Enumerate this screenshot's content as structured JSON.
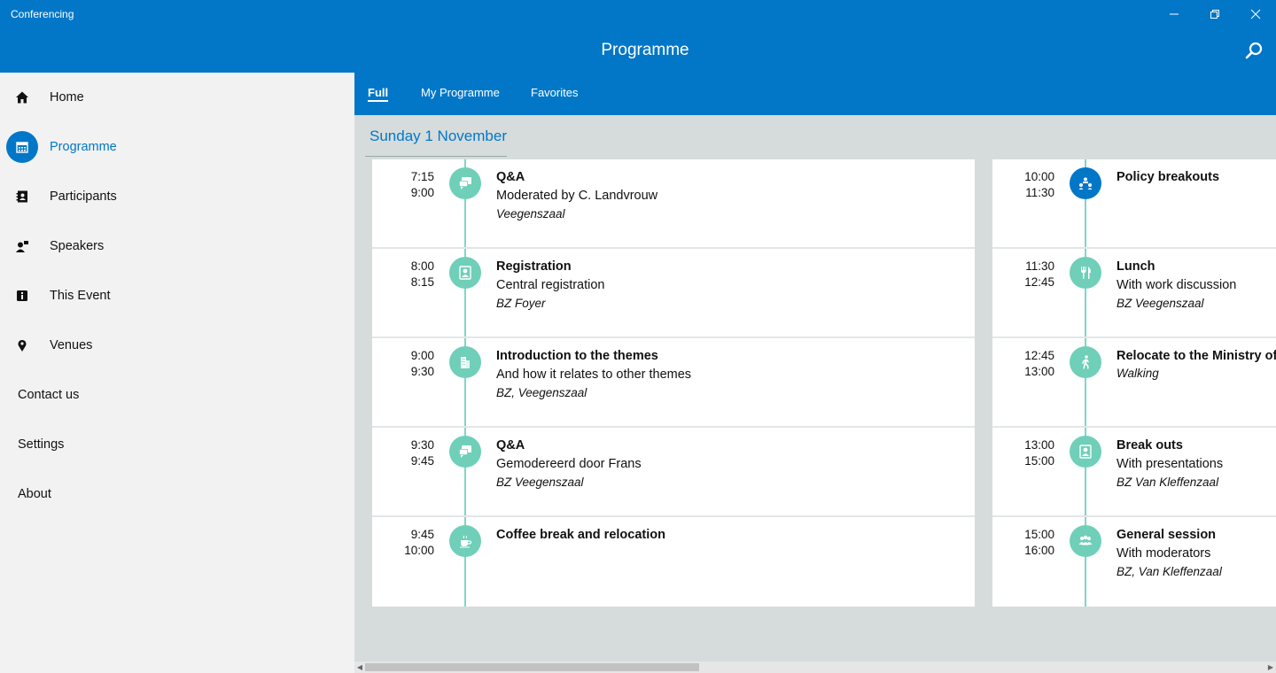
{
  "app": {
    "title": "Conferencing"
  },
  "header": {
    "page_title": "Programme"
  },
  "colors": {
    "accent": "#0277c8",
    "timeline": "#6fcfb9",
    "content_bg": "#d6dcdc"
  },
  "sidebar": {
    "items": [
      {
        "label": "Home",
        "icon": "home-icon"
      },
      {
        "label": "Programme",
        "icon": "calendar-icon",
        "active": true
      },
      {
        "label": "Participants",
        "icon": "contacts-icon"
      },
      {
        "label": "Speakers",
        "icon": "speaker-icon"
      },
      {
        "label": "This Event",
        "icon": "info-icon"
      },
      {
        "label": "Venues",
        "icon": "map-pin-icon"
      },
      {
        "label": "Contact us"
      },
      {
        "label": "Settings"
      },
      {
        "label": "About"
      }
    ]
  },
  "tabs": [
    {
      "label": "Full",
      "active": true
    },
    {
      "label": "My Programme"
    },
    {
      "label": "Favorites"
    }
  ],
  "day": {
    "title": "Sunday 1 November"
  },
  "columns": [
    {
      "sessions": [
        {
          "start": "7:15",
          "end": "9:00",
          "title": "Q&A",
          "subtitle": "Moderated by C. Landvrouw",
          "location": "Veegenszaal",
          "icon": "chat-icon"
        },
        {
          "start": "8:00",
          "end": "8:15",
          "title": "Registration",
          "subtitle": "Central registration",
          "location": "BZ Foyer",
          "icon": "person-badge-icon"
        },
        {
          "start": "9:00",
          "end": "9:30",
          "title": "Introduction to the themes",
          "subtitle": "And how it relates to other themes",
          "location": "BZ, Veegenszaal",
          "icon": "building-icon"
        },
        {
          "start": "9:30",
          "end": "9:45",
          "title": "Q&A",
          "subtitle": "Gemodereerd door Frans",
          "location": "BZ Veegenszaal",
          "icon": "chat-icon"
        },
        {
          "start": "9:45",
          "end": "10:00",
          "title": "Coffee break and relocation",
          "subtitle": "",
          "location": "",
          "icon": "coffee-icon"
        }
      ]
    },
    {
      "sessions": [
        {
          "start": "10:00",
          "end": "11:30",
          "title": "Policy breakouts",
          "subtitle": "",
          "location": "",
          "icon": "breakout-icon",
          "highlight": true
        },
        {
          "start": "11:30",
          "end": "12:45",
          "title": "Lunch",
          "subtitle": "With work discussion",
          "location": "BZ Veegenszaal",
          "icon": "cutlery-icon"
        },
        {
          "start": "12:45",
          "end": "13:00",
          "title": "Relocate to the Ministry of",
          "subtitle": "",
          "location": "Walking",
          "icon": "walking-icon"
        },
        {
          "start": "13:00",
          "end": "15:00",
          "title": "Break outs",
          "subtitle": "With presentations",
          "location": "BZ Van Kleffenzaal",
          "icon": "person-badge-icon"
        },
        {
          "start": "15:00",
          "end": "16:00",
          "title": "General session",
          "subtitle": "With moderators",
          "location": "BZ, Van Kleffenzaal",
          "icon": "group-icon"
        }
      ]
    }
  ]
}
